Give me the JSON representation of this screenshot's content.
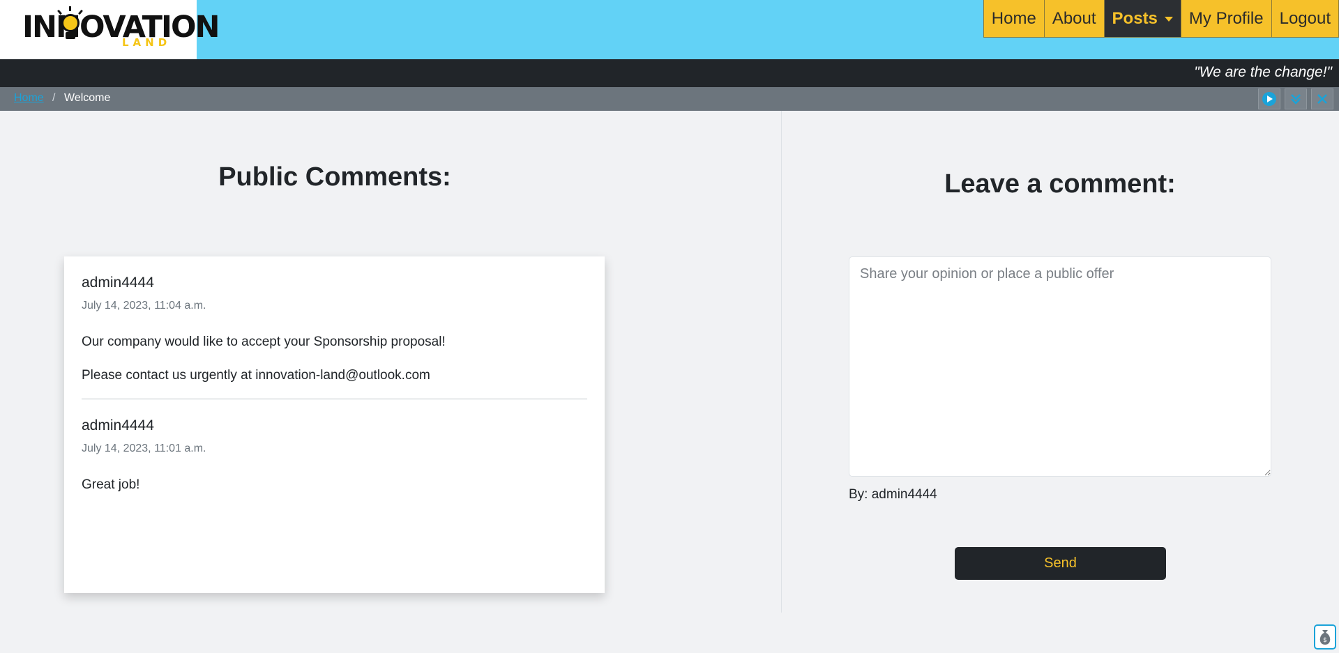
{
  "brand": {
    "logo_main": "INNOVATION",
    "logo_sub": "LAND",
    "accent": "#f6c12a",
    "header_bg": "#62d2f6"
  },
  "nav": {
    "items": [
      {
        "label": "Home"
      },
      {
        "label": "About"
      },
      {
        "label": "Posts",
        "active": true,
        "icon": "caret-down-icon"
      },
      {
        "label": "My Profile"
      },
      {
        "label": "Logout"
      }
    ]
  },
  "slogan": "\"We are the change!\"",
  "breadcrumb": {
    "home": "Home",
    "separator": "/",
    "current": "Welcome",
    "tools": [
      "play-icon",
      "double-chevron-down-icon",
      "close-icon"
    ]
  },
  "public_comments": {
    "title": "Public Comments:",
    "items": [
      {
        "author": "admin4444",
        "date": "July 14, 2023, 11:04 a.m.",
        "lines": [
          "Our company would like to accept your Sponsorship proposal!",
          "Please contact us urgently at innovation-land@outlook.com"
        ]
      },
      {
        "author": "admin4444",
        "date": "July 14, 2023, 11:01 a.m.",
        "lines": [
          "Great job!"
        ]
      }
    ]
  },
  "leave_comment": {
    "title": "Leave a comment:",
    "placeholder": "Share your opinion or place a public offer",
    "value": "",
    "by_line": "By: admin4444",
    "send_label": "Send"
  },
  "corner_widget": {
    "icon": "money-bag-icon"
  }
}
